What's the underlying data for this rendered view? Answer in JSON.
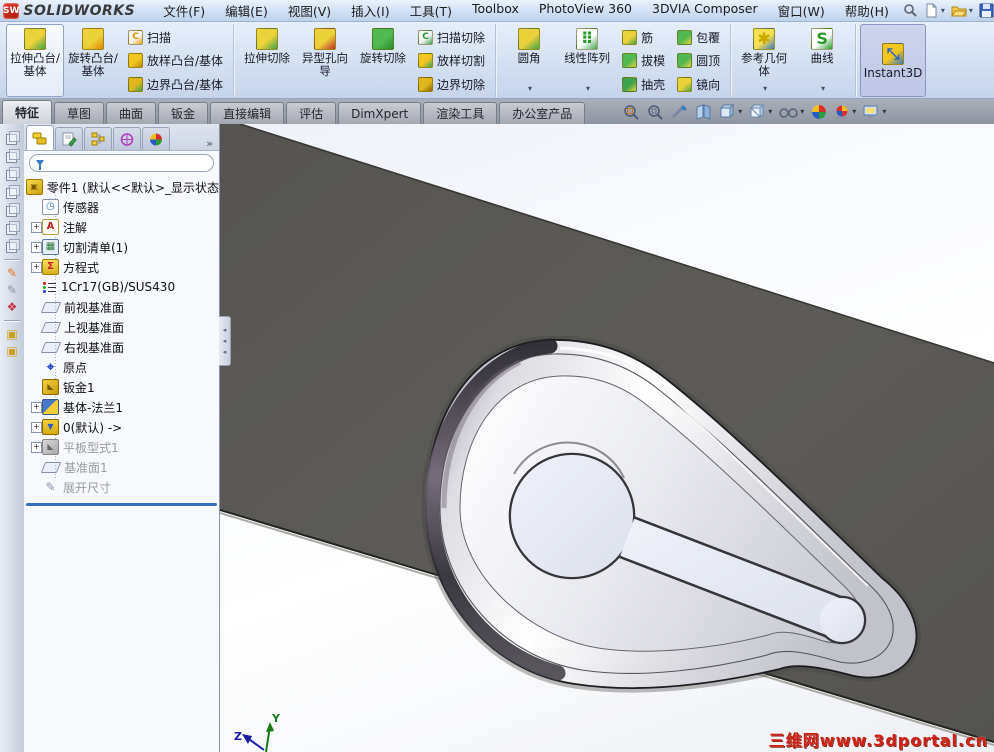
{
  "titlebar": {
    "logo": "SW",
    "brand": "SOLIDWORKS",
    "menus": [
      "文件(F)",
      "编辑(E)",
      "视图(V)",
      "插入(I)",
      "工具(T)",
      "Toolbox",
      "PhotoView 360",
      "3DVIA Composer",
      "窗口(W)",
      "帮助(H)"
    ],
    "quick_tools": [
      {
        "name": "search",
        "dd": false
      },
      {
        "name": "new-document",
        "dd": true
      },
      {
        "name": "open",
        "dd": true
      },
      {
        "name": "save",
        "dd": true
      },
      {
        "name": "print",
        "dd": true
      },
      {
        "name": "undo",
        "dd": true
      },
      {
        "name": "select",
        "dd": true
      }
    ]
  },
  "ribbon": {
    "groups": [
      {
        "buttons": [
          {
            "t": "big",
            "label": "拉伸凸台/基体",
            "icon": "extrude-boss",
            "c": "#ecd23a",
            "a": "#3fa34d",
            "g": "",
            "framed": true
          },
          {
            "t": "big",
            "label": "旋转凸台/基体",
            "icon": "revolve-boss",
            "c": "#ecd23a",
            "a": "#e08a00",
            "g": ""
          },
          {
            "t": "stack",
            "items": [
              {
                "label": "扫描",
                "icon": "sweep",
                "c": "#f5f5f5",
                "a": "#f0a000",
                "g": "C",
                "gc": "#e89000"
              },
              {
                "label": "放样凸台/基体",
                "icon": "loft",
                "c": "#f2c520",
                "a": "#b88a00",
                "g": ""
              },
              {
                "label": "边界凸台/基体",
                "icon": "boundary",
                "c": "#e0b81e",
                "a": "#3fa34d",
                "g": ""
              }
            ]
          }
        ]
      },
      {
        "buttons": [
          {
            "t": "big",
            "label": "拉伸切除",
            "icon": "extrude-cut",
            "c": "#ecd23a",
            "a": "#3fa34d",
            "g": ""
          },
          {
            "t": "big",
            "label": "异型孔向导",
            "icon": "hole-wizard",
            "c": "#ecd23a",
            "a": "#c03030",
            "g": ""
          },
          {
            "t": "big",
            "label": "旋转切除",
            "icon": "revolve-cut",
            "c": "#52b852",
            "a": "#2a8a2a",
            "g": ""
          },
          {
            "t": "stack",
            "items": [
              {
                "label": "扫描切除",
                "icon": "sweep-cut",
                "c": "#f5f5f5",
                "a": "#3fa34d",
                "g": "C",
                "gc": "#2a9a2a"
              },
              {
                "label": "放样切割",
                "icon": "loft-cut",
                "c": "#f2c520",
                "a": "#3fa34d",
                "g": ""
              },
              {
                "label": "边界切除",
                "icon": "boundary-cut",
                "c": "#e0b81e",
                "a": "#8a6a00",
                "g": ""
              }
            ]
          }
        ]
      },
      {
        "buttons": [
          {
            "t": "big",
            "label": "圆角",
            "icon": "fillet",
            "c": "#ecd23a",
            "a": "#3fa34d",
            "g": "",
            "dd": true
          },
          {
            "t": "big",
            "label": "线性阵列",
            "icon": "linear-pattern",
            "c": "#fff",
            "a": "#3fa34d",
            "g": "⠿",
            "gc": "#2a9a2a",
            "dd": true
          },
          {
            "t": "stack",
            "items": [
              {
                "label": "筋",
                "icon": "rib",
                "c": "#ecd23a",
                "a": "#3fa34d",
                "g": ""
              },
              {
                "label": "拔模",
                "icon": "draft",
                "c": "#52b852",
                "a": "#ecd23a",
                "g": ""
              },
              {
                "label": "抽壳",
                "icon": "shell",
                "c": "#3fa34d",
                "a": "#ecd23a",
                "g": ""
              }
            ]
          },
          {
            "t": "stack",
            "items": [
              {
                "label": "包覆",
                "icon": "wrap",
                "c": "#52b852",
                "a": "#ecd23a",
                "g": ""
              },
              {
                "label": "圆顶",
                "icon": "dome",
                "c": "#52b852",
                "a": "#ecd23a",
                "g": ""
              },
              {
                "label": "镜向",
                "icon": "mirror",
                "c": "#ecd23a",
                "a": "#3fa34d",
                "g": ""
              }
            ]
          }
        ]
      },
      {
        "buttons": [
          {
            "t": "big",
            "label": "参考几何体",
            "icon": "reference-geometry",
            "c": "#f5e050",
            "a": "#3a7ac2",
            "g": "✱",
            "gc": "#caa800",
            "dd": true
          },
          {
            "t": "big",
            "label": "曲线",
            "icon": "curve",
            "c": "#fff",
            "a": "#2a9a2a",
            "g": "S",
            "gc": "#2a9a2a",
            "dd": true
          }
        ]
      },
      {
        "buttons": [
          {
            "t": "big",
            "label": "Instant3D",
            "icon": "instant3d",
            "c": "#f2c520",
            "a": "#3a7ac2",
            "g": "⤡",
            "gc": "#2a60c0",
            "pressed": true
          }
        ]
      }
    ]
  },
  "tabs": {
    "active": "特征",
    "items": [
      "特征",
      "草图",
      "曲面",
      "钣金",
      "直接编辑",
      "评估",
      "DimXpert",
      "渲染工具",
      "办公室产品"
    ]
  },
  "headsup": [
    {
      "name": "zoom-fit",
      "dd": false
    },
    {
      "name": "zoom-area",
      "dd": false
    },
    {
      "name": "previous-view",
      "dd": false
    },
    {
      "name": "section-view",
      "dd": false
    },
    {
      "name": "view-orientation",
      "dd": true
    },
    {
      "name": "display-style",
      "dd": true
    },
    {
      "name": "hide-show-items",
      "dd": true
    },
    {
      "name": "edit-appearance",
      "dd": false
    },
    {
      "name": "apply-scene",
      "dd": true
    },
    {
      "name": "view-settings",
      "dd": true
    }
  ],
  "left_toolbar": {
    "cubes": 7,
    "extras": [
      {
        "name": "sketch",
        "glyph": "✎",
        "color": "#e07818"
      },
      {
        "name": "smart-dimension",
        "glyph": "✎",
        "color": "#8a92a4"
      },
      {
        "name": "mate",
        "glyph": "❖",
        "color": "#c03040"
      },
      {
        "name": "feature-boss-1",
        "glyph": "▣",
        "color": "#caa210"
      },
      {
        "name": "feature-boss-2",
        "glyph": "▣",
        "color": "#caa210"
      }
    ]
  },
  "panel": {
    "tabs": [
      "feature-manager",
      "property-manager",
      "configuration-manager",
      "dimxpert-manager",
      "display-manager"
    ],
    "overflow": "»",
    "filter_placeholder": "",
    "root": "零件1  (默认<<默认>_显示状态",
    "tree": [
      {
        "label": "传感器",
        "icon": "sensors",
        "expand": false,
        "grayed": false
      },
      {
        "label": "注解",
        "icon": "annotations",
        "expand": true,
        "grayed": false
      },
      {
        "label": "切割清单(1)",
        "icon": "cutlist",
        "expand": true,
        "grayed": false
      },
      {
        "label": "方程式",
        "icon": "equations",
        "expand": true,
        "grayed": false
      },
      {
        "label": "1Cr17(GB)/SUS430",
        "icon": "material",
        "expand": false,
        "grayed": false
      },
      {
        "label": "前视基准面",
        "icon": "plane",
        "expand": false,
        "grayed": false
      },
      {
        "label": "上视基准面",
        "icon": "plane",
        "expand": false,
        "grayed": false
      },
      {
        "label": "右视基准面",
        "icon": "plane",
        "expand": false,
        "grayed": false
      },
      {
        "label": "原点",
        "icon": "origin",
        "expand": false,
        "grayed": false
      },
      {
        "label": "钣金1",
        "icon": "sheet-metal",
        "expand": false,
        "grayed": false
      },
      {
        "label": "基体-法兰1",
        "icon": "base-flange",
        "expand": true,
        "grayed": false
      },
      {
        "label": "0(默认) ->",
        "icon": "flat-config",
        "expand": true,
        "grayed": false
      },
      {
        "label": "平板型式1",
        "icon": "flat-pattern",
        "expand": true,
        "grayed": true
      },
      {
        "label": "基准面1",
        "icon": "plane",
        "expand": false,
        "grayed": true
      },
      {
        "label": "展开尺寸",
        "icon": "unfold-dimension",
        "expand": false,
        "grayed": true
      }
    ]
  },
  "viewport": {
    "watermark": "三维网www.3dportal.cn",
    "triad": {
      "y_label": "Y",
      "z_label": "Z"
    },
    "colors": {
      "plate": "#595855",
      "plate_edge": "#32312d",
      "background_top": "#eef1f8",
      "chrome_dark": "#2c2a31",
      "chrome_light": "#f6f6f8"
    }
  }
}
